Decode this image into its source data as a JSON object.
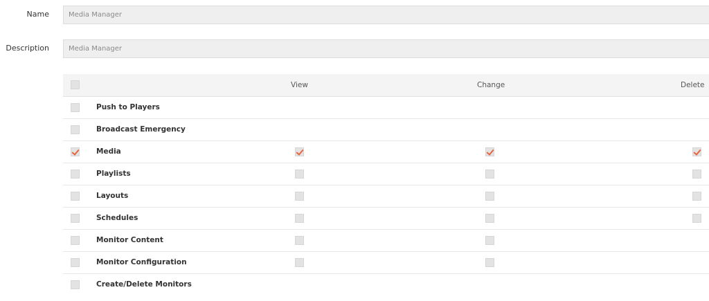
{
  "form": {
    "name_label": "Name",
    "name_placeholder": "Media Manager",
    "description_label": "Description",
    "description_placeholder": "Media Manager"
  },
  "table": {
    "headers": {
      "view": "View",
      "change": "Change",
      "delete": "Delete"
    },
    "header_checked": false,
    "rows": [
      {
        "label": "Push to Players",
        "selected": false,
        "view": null,
        "change": null,
        "delete": null
      },
      {
        "label": "Broadcast Emergency",
        "selected": false,
        "view": null,
        "change": null,
        "delete": null
      },
      {
        "label": "Media",
        "selected": true,
        "view": true,
        "change": true,
        "delete": true
      },
      {
        "label": "Playlists",
        "selected": false,
        "view": false,
        "change": false,
        "delete": false
      },
      {
        "label": "Layouts",
        "selected": false,
        "view": false,
        "change": false,
        "delete": false
      },
      {
        "label": "Schedules",
        "selected": false,
        "view": false,
        "change": false,
        "delete": false
      },
      {
        "label": "Monitor Content",
        "selected": false,
        "view": false,
        "change": false,
        "delete": null
      },
      {
        "label": "Monitor Configuration",
        "selected": false,
        "view": false,
        "change": false,
        "delete": null
      },
      {
        "label": "Create/Delete Monitors",
        "selected": false,
        "view": null,
        "change": null,
        "delete": null
      }
    ]
  },
  "colors": {
    "accent": "#e8643c",
    "input_bg": "#efefef",
    "checkbox_bg": "#e3e3e3"
  }
}
